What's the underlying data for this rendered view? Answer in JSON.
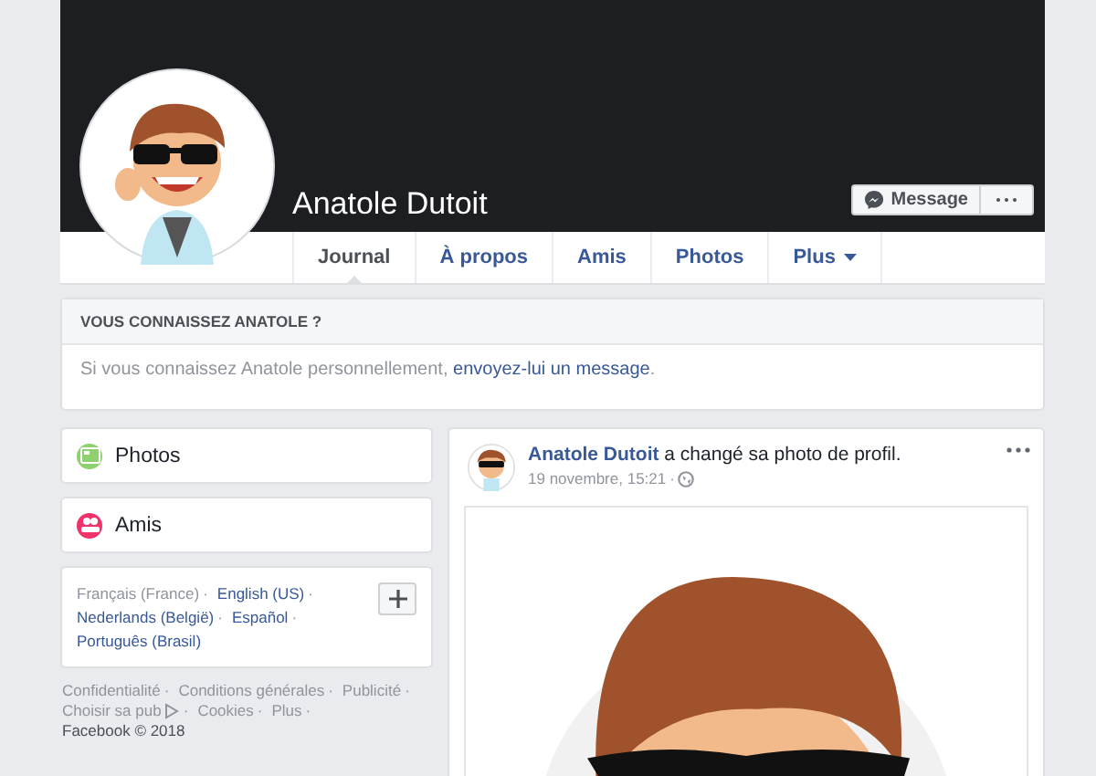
{
  "profile": {
    "name": "Anatole Dutoit",
    "message_button": "Message",
    "tabs": [
      {
        "label": "Journal",
        "selected": true,
        "dropdown": false
      },
      {
        "label": "À propos",
        "selected": false,
        "dropdown": false
      },
      {
        "label": "Amis",
        "selected": false,
        "dropdown": false
      },
      {
        "label": "Photos",
        "selected": false,
        "dropdown": false
      },
      {
        "label": "Plus",
        "selected": false,
        "dropdown": true
      }
    ]
  },
  "notice": {
    "title": "VOUS CONNAISSEZ ANATOLE ?",
    "text": "Si vous connaissez Anatole personnellement, ",
    "link": "envoyez-lui un message",
    "end": "."
  },
  "sidebar": {
    "items": [
      {
        "label": "Photos",
        "kind": "photos",
        "color": "#8ed16e"
      },
      {
        "label": "Amis",
        "kind": "friends",
        "color": "#f0326a"
      }
    ]
  },
  "separator": "·",
  "languages": [
    {
      "label": "Français (France)",
      "selected": true
    },
    {
      "label": "English (US)",
      "selected": false
    },
    {
      "label": "Nederlands (België)",
      "selected": false
    },
    {
      "label": "Español",
      "selected": false
    },
    {
      "label": "Português (Brasil)",
      "selected": false
    }
  ],
  "footer": {
    "links": [
      {
        "label": "Confidentialité",
        "adchoices": false
      },
      {
        "label": "Conditions générales",
        "adchoices": false
      },
      {
        "label": "Publicité",
        "adchoices": false
      },
      {
        "label": "Choisir sa pub",
        "adchoices": true
      },
      {
        "label": "Cookies",
        "adchoices": false
      },
      {
        "label": "Plus",
        "adchoices": false
      }
    ],
    "copyright": "Facebook © 2018"
  },
  "post": {
    "author": "Anatole Dutoit",
    "action": "a changé sa photo de profil.",
    "time": "19 novembre, 15:21"
  }
}
